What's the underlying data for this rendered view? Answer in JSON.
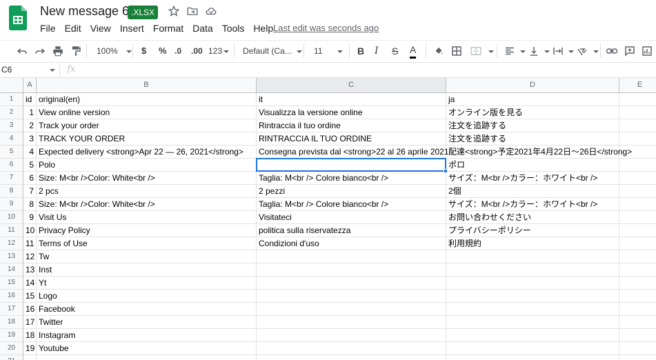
{
  "header": {
    "title": "New message 6",
    "badge": ".XLSX",
    "menu": [
      "File",
      "Edit",
      "View",
      "Insert",
      "Format",
      "Data",
      "Tools",
      "Help"
    ],
    "last_edit": "Last edit was seconds ago"
  },
  "toolbar": {
    "zoom": "100%",
    "currency": "$",
    "percent": "%",
    "dec_less": ".0",
    "dec_more": ".00",
    "more_formats": "123",
    "font": "Default (Ca...",
    "font_size": "11",
    "bold": "B",
    "italic": "I",
    "strike": "S",
    "text_color": "A"
  },
  "formula_bar": {
    "cell_ref": "C6",
    "fx": "fx",
    "value": ""
  },
  "columns": [
    "A",
    "B",
    "C",
    "D",
    "E"
  ],
  "selected_column": "C",
  "rows": [
    [
      "id",
      "original(en)",
      "it",
      "ja"
    ],
    [
      "1",
      "View online version",
      "Visualizza la versione online",
      "オンライン版を見る"
    ],
    [
      "2",
      "Track your order",
      "Rintraccia il tuo ordine",
      "注文を追跡する"
    ],
    [
      "3",
      "TRACK YOUR ORDER",
      "RINTRACCIA IL TUO ORDINE",
      "注文を追跡する"
    ],
    [
      "4",
      "Expected delivery <strong>Apr 22 — 26, 2021</strong>",
      "Consegna prevista dal <strong>22 al 26 aprile 2021",
      "配達<strong>予定2021年4月22日～26日</strong>"
    ],
    [
      "5",
      "Polo",
      "",
      "ポロ"
    ],
    [
      "6",
      "Size: M<br />Color: White<br />",
      "Taglia: M<br /> Colore bianco<br />",
      "サイズ：M<br />カラー：ホワイト<br />"
    ],
    [
      "7",
      "2 pcs",
      "2 pezzi",
      "2個"
    ],
    [
      "8",
      "Size: M<br />Color: White<br />",
      "Taglia: M<br /> Colore bianco<br />",
      "サイズ：M<br />カラー：ホワイト<br />"
    ],
    [
      "9",
      "Visit Us",
      "Visitateci",
      "お問い合わせください"
    ],
    [
      "10",
      "Privacy Policy",
      "politica sulla riservatezza",
      "プライバシーポリシー"
    ],
    [
      "11",
      "Terms of Use",
      "Condizioni d'uso",
      "利用規約"
    ],
    [
      "12",
      "Tw",
      "",
      ""
    ],
    [
      "13",
      "Inst",
      "",
      ""
    ],
    [
      "14",
      "Yt",
      "",
      ""
    ],
    [
      "15",
      "Logo",
      "",
      ""
    ],
    [
      "16",
      "Facebook",
      "",
      ""
    ],
    [
      "17",
      "Twitter",
      "",
      ""
    ],
    [
      "18",
      "Instagram",
      "",
      ""
    ],
    [
      "19",
      "Youtube",
      "",
      ""
    ],
    [
      "",
      "",
      "",
      ""
    ]
  ],
  "colors": {
    "accent": "#1a73e8",
    "brand": "#0f9d58",
    "badge": "#188038"
  }
}
